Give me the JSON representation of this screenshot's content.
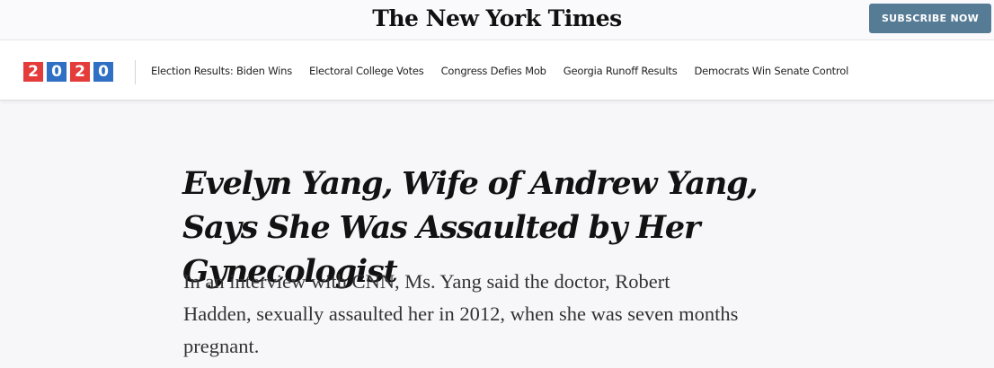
{
  "header": {
    "masthead": "The New York Times",
    "subscribe_label": "SUBSCRIBE NOW"
  },
  "nav": {
    "logo_digits": [
      "2",
      "0",
      "2",
      "0"
    ],
    "logo_colors": [
      "#e43b3b",
      "#2f6fc4",
      "#e43b3b",
      "#2f6fc4"
    ],
    "links": [
      "Election Results: Biden Wins",
      "Electoral College Votes",
      "Congress Defies Mob",
      "Georgia Runoff Results",
      "Democrats Win Senate Control"
    ]
  },
  "article": {
    "headline": "Evelyn Yang, Wife of Andrew Yang, Says She Was Assaulted by Her Gynecologist",
    "summary": "In an interview with CNN, Ms. Yang said the doctor, Robert Hadden, sexually assaulted her in 2012, when she was seven months pregnant."
  },
  "colors": {
    "subscribe_button": "#567b95",
    "logo_red": "#e43b3b",
    "logo_blue": "#2f6fc4"
  }
}
